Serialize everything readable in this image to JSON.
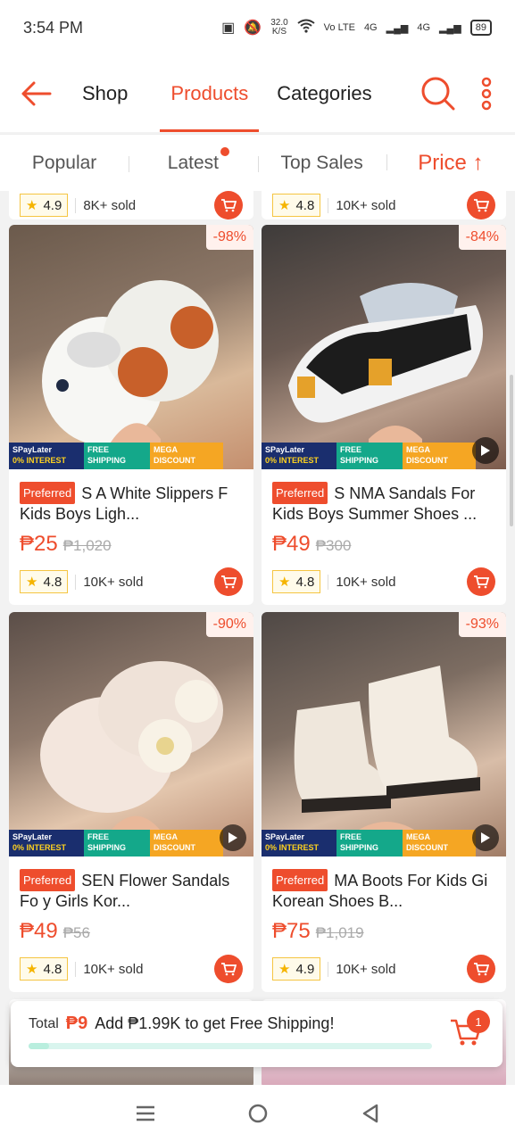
{
  "status": {
    "time": "3:54 PM",
    "speed": "32.0",
    "speed_unit": "K/S",
    "battery": "89",
    "net1": "Vo LTE",
    "net2": "4G",
    "net3": "4G"
  },
  "nav": {
    "tabs": [
      "Shop",
      "Products",
      "Categories"
    ],
    "active_tab": "Products"
  },
  "sort": {
    "items": [
      "Popular",
      "Latest",
      "Top Sales",
      "Price ↑"
    ]
  },
  "partial_top": [
    {
      "rating": "4.9",
      "sold": "8K+ sold"
    },
    {
      "rating": "4.8",
      "sold": "10K+ sold"
    }
  ],
  "products": [
    {
      "discount": "-98%",
      "badge": "Preferred",
      "title": "S      A White Slippers F   Kids Boys Ligh...",
      "price": "₱25",
      "original": "₱1,020",
      "rating": "4.8",
      "sold": "10K+ sold",
      "video": false
    },
    {
      "discount": "-84%",
      "badge": "Preferred",
      "title": "S  NMA Sandals For Kids Boys Summer Shoes ...",
      "price": "₱49",
      "original": "₱300",
      "rating": "4.8",
      "sold": "10K+ sold",
      "video": true
    },
    {
      "discount": "-90%",
      "badge": "Preferred",
      "title": "SEN     Flower Sandals Fo    y Girls Kor...",
      "price": "₱49",
      "original": "₱56",
      "rating": "4.8",
      "sold": "10K+ sold",
      "video": true
    },
    {
      "discount": "-93%",
      "badge": "Preferred",
      "title": "     MA Boots For Kids Gi   Korean Shoes B...",
      "price": "₱75",
      "original": "₱1,019",
      "rating": "4.9",
      "sold": "10K+ sold",
      "video": true
    }
  ],
  "promo": {
    "spay": "SPayLater",
    "interest": "0% INTEREST",
    "free": "FREE",
    "shipping": "SHIPPING",
    "mega": "MEGA",
    "discount": "DISCOUNT"
  },
  "shipping": {
    "total_label": "Total",
    "total_amount": "₱9",
    "message": "Add ₱1.99K to get Free Shipping!",
    "cart_count": "1",
    "progress": 0.05
  },
  "colors": {
    "accent": "#ee4d2d"
  }
}
